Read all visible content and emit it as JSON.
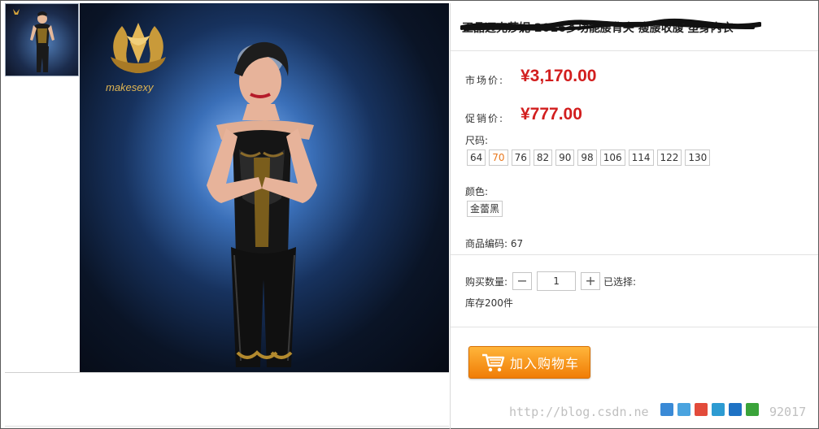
{
  "product": {
    "title": "正品迈克莎妮 2016多功能腰背夹 瘦腰收腹 塑身内衣",
    "logo_text": "makesexy"
  },
  "prices": {
    "market_label": "市场价:",
    "market_value": "¥3,170.00",
    "promo_label": "促销价:",
    "promo_value": "¥777.00"
  },
  "size": {
    "label": "尺码:",
    "options": [
      "64",
      "70",
      "76",
      "82",
      "90",
      "98",
      "106",
      "114",
      "122",
      "130"
    ],
    "selected": "70"
  },
  "color": {
    "label": "颜色:",
    "options": [
      "金蕾黑"
    ]
  },
  "code": {
    "label": "商品编码:",
    "value": "67"
  },
  "purchase": {
    "qty_label": "购买数量:",
    "minus": "−",
    "plus": "+",
    "qty_value": "1",
    "selected_label": "已选择:",
    "stock": "库存200件"
  },
  "cart_button": {
    "label": "加入购物车"
  },
  "watermark": {
    "text": "http://blog.csdn.ne",
    "tail": "92017"
  },
  "share_icons": [
    "plus-share-icon",
    "qzone-icon",
    "weibo-icon",
    "tqq-icon",
    "renren-icon",
    "wechat-icon"
  ],
  "colors": {
    "price_red": "#d21e1e",
    "accent_orange": "#f07d06",
    "selected_size": "#e9781d"
  }
}
